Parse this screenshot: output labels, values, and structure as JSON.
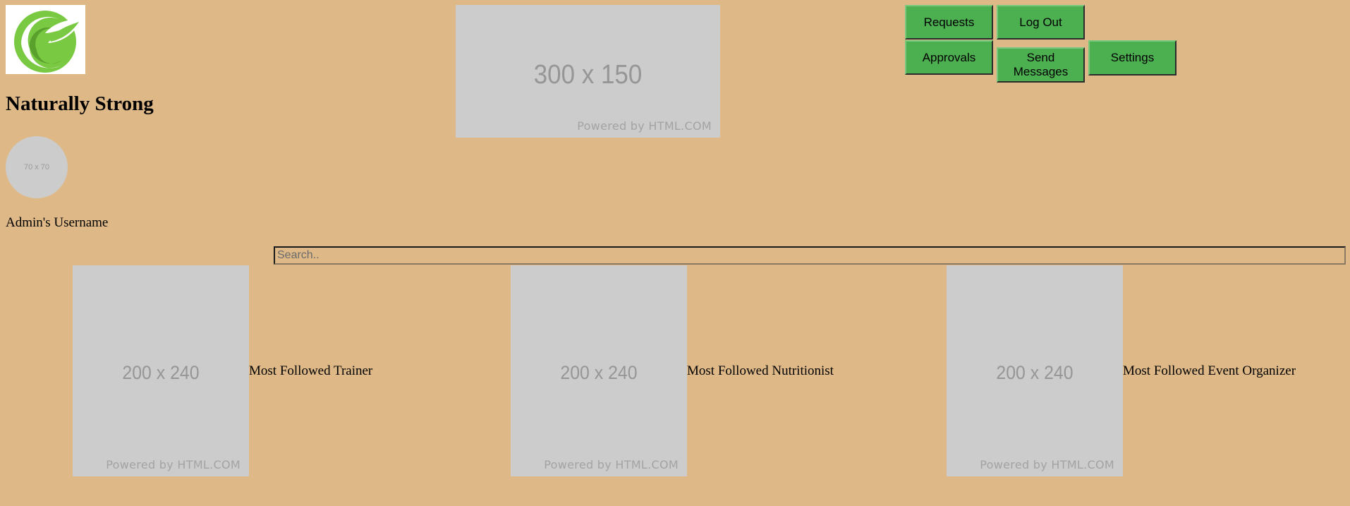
{
  "header": {
    "site_title": "Naturally Strong",
    "logo_icon": "leaf-logo-icon",
    "brand_colors": {
      "leaf_green": "#7ac943",
      "leaf_dark": "#5aa02c"
    }
  },
  "banner": {
    "dims": "300 x 150",
    "powered": "Powered by HTML.COM"
  },
  "nav": {
    "requests": "Requests",
    "log_out": "Log Out",
    "approvals": "Approvals",
    "send_messages": "Send Messages",
    "settings": "Settings",
    "button_color": "#4CAF50"
  },
  "profile": {
    "avatar_dims": "70 x 70",
    "username": "Admin's Username"
  },
  "search": {
    "placeholder": "Search.."
  },
  "cards": [
    {
      "img_dims": "200 x 240",
      "img_powered": "Powered by HTML.COM",
      "label": "Most Followed Trainer"
    },
    {
      "img_dims": "200 x 240",
      "img_powered": "Powered by HTML.COM",
      "label": "Most Followed Nutritionist"
    },
    {
      "img_dims": "200 x 240",
      "img_powered": "Powered by HTML.COM",
      "label": "Most Followed Event Organizer"
    }
  ],
  "theme": {
    "background": "#DEB887",
    "placeholder_gray": "#cccccc"
  }
}
